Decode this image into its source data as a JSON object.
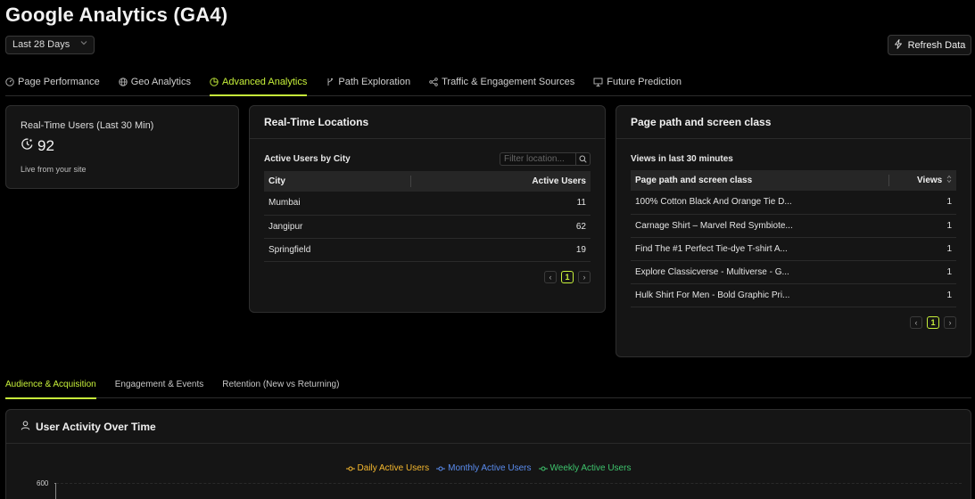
{
  "header": {
    "title": "Google Analytics (GA4)",
    "date_range": "Last 28 Days",
    "refresh_label": "Refresh Data"
  },
  "tabs": [
    {
      "label": "Page Performance",
      "icon": "gauge-icon"
    },
    {
      "label": "Geo Analytics",
      "icon": "globe-icon"
    },
    {
      "label": "Advanced Analytics",
      "icon": "pie-icon",
      "active": true
    },
    {
      "label": "Path Exploration",
      "icon": "branch-icon"
    },
    {
      "label": "Traffic & Engagement Sources",
      "icon": "share-icon"
    },
    {
      "label": "Future Prediction",
      "icon": "presentation-icon"
    }
  ],
  "realtime": {
    "label": "Real-Time Users (Last 30 Min)",
    "value": "92",
    "subtitle": "Live from your site"
  },
  "locations": {
    "title": "Real-Time Locations",
    "subtitle": "Active Users by City",
    "filter_placeholder": "Filter location...",
    "columns": [
      "City",
      "Active Users"
    ],
    "rows": [
      {
        "city": "Mumbai",
        "users": "11"
      },
      {
        "city": "Jangipur",
        "users": "62"
      },
      {
        "city": "Springfield",
        "users": "19"
      }
    ],
    "page": "1"
  },
  "pages": {
    "title": "Page path and screen class",
    "subtitle": "Views in last 30 minutes",
    "columns": [
      "Page path and screen class",
      "Views"
    ],
    "rows": [
      {
        "path": "100% Cotton Black And Orange Tie D...",
        "views": "1"
      },
      {
        "path": "Carnage Shirt – Marvel Red Symbiote...",
        "views": "1"
      },
      {
        "path": "Find The #1 Perfect Tie-dye T-shirt A...",
        "views": "1"
      },
      {
        "path": "Explore Classicverse - Multiverse - G...",
        "views": "1"
      },
      {
        "path": "Hulk Shirt For Men - Bold Graphic Pri...",
        "views": "1"
      }
    ],
    "page": "1"
  },
  "subtabs": [
    {
      "label": "Audience & Acquisition",
      "active": true
    },
    {
      "label": "Engagement & Events"
    },
    {
      "label": "Retention (New vs Returning)"
    }
  ],
  "activity": {
    "title": "User Activity Over Time",
    "legend": [
      {
        "label": "Daily Active Users",
        "color": "#f5b82e"
      },
      {
        "label": "Monthly Active Users",
        "color": "#5b8def"
      },
      {
        "label": "Weekly Active Users",
        "color": "#3ec46d"
      }
    ],
    "y_top_tick": "600"
  },
  "colors": {
    "accent": "#c7f03a",
    "background": "#000000",
    "card": "#151515"
  }
}
